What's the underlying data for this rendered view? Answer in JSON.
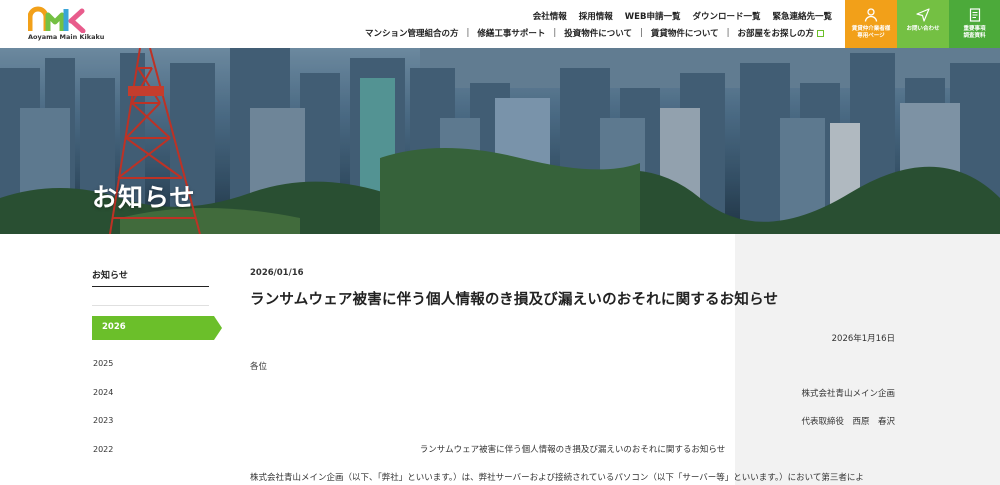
{
  "logo": {
    "text": "Aoyama Main Kikaku",
    "colors": [
      "#f2a019",
      "#74c043",
      "#3aa5d8",
      "#e85c8c"
    ]
  },
  "util_nav": [
    "会社情報",
    "採用情報",
    "WEB申請一覧",
    "ダウンロード一覧",
    "緊急連絡先一覧"
  ],
  "main_nav": [
    "マンション管理組合の方",
    "修繕工事サポート",
    "投資物件について",
    "賃貸物件について",
    "お部屋をお探しの方"
  ],
  "cta": [
    {
      "label": "賃貸仲介業者様\n専用ページ",
      "icon": "person-icon",
      "color": "#f2a019"
    },
    {
      "label": "お問い合わせ",
      "icon": "paper-plane-icon",
      "color": "#74c043"
    },
    {
      "label": "重要事項\n調査資料",
      "icon": "document-icon",
      "color": "#4caa3a"
    }
  ],
  "hero": {
    "title": "お知らせ"
  },
  "sidebar": {
    "title": "お知らせ",
    "active_year": "2026",
    "years": [
      "2025",
      "2024",
      "2023",
      "2022"
    ],
    "accent": "#6bbf2a"
  },
  "article": {
    "date": "2026/01/16",
    "title": "ランサムウェア被害に伴う個人情報のき損及び漏えいのおそれに関するお知らせ",
    "issue_date": "2026年1月16日",
    "addressee": "各位",
    "company": "株式会社青山メイン企画",
    "representative": "代表取締役　西原　春沢",
    "subject": "ランサムウェア被害に伴う個人情報のき損及び漏えいのおそれに関するお知らせ",
    "body": "株式会社青山メイン企画（以下、「弊社」といいます。）は、弊社サーバーおよび接続されているパソコン（以下「サーバー等」といいます。）において第三者によ"
  }
}
